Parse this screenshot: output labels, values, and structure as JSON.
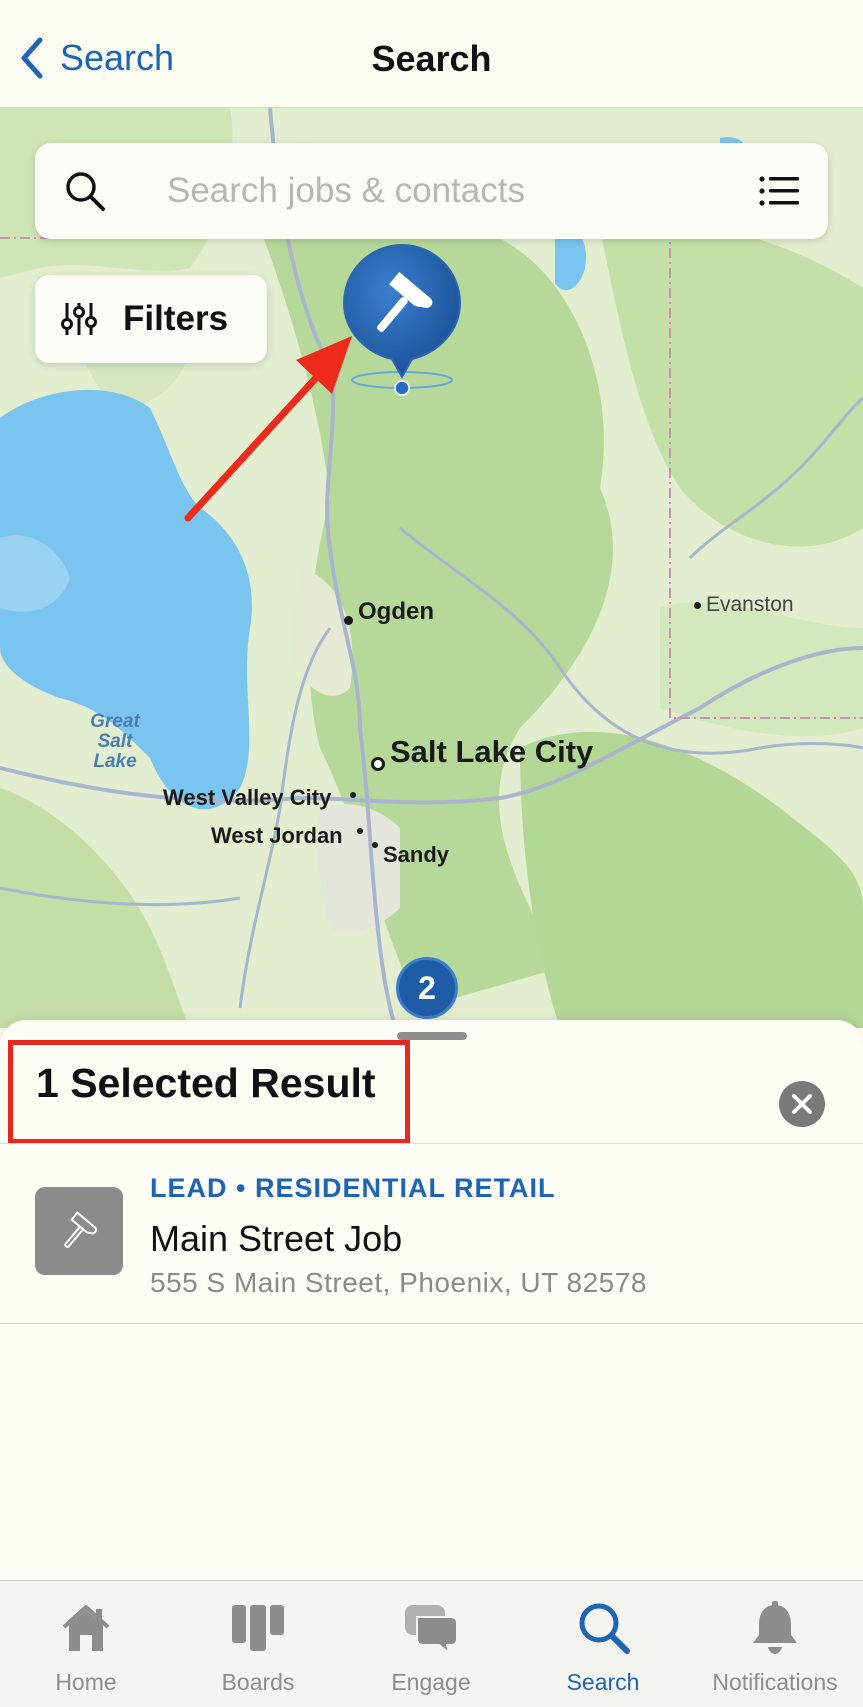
{
  "nav": {
    "back_label": "Search",
    "title": "Search"
  },
  "map": {
    "search_placeholder": "Search jobs & contacts",
    "filters_label": "Filters",
    "cluster_count": "2",
    "labels": {
      "ogden": "Ogden",
      "evanston": "Evanston",
      "salt_lake_city": "Salt Lake City",
      "west_valley_city": "West Valley City",
      "west_jordan": "West Jordan",
      "sandy": "Sandy",
      "lake_line1": "Great",
      "lake_line2": "Salt",
      "lake_line3": "Lake"
    }
  },
  "sheet": {
    "title": "1 Selected Result",
    "results": [
      {
        "type": "LEAD • RESIDENTIAL RETAIL",
        "title": "Main Street Job",
        "address": "555 S Main Street, Phoenix, UT 82578"
      }
    ]
  },
  "tabs": [
    {
      "label": "Home",
      "icon": "house-icon"
    },
    {
      "label": "Boards",
      "icon": "boards-icon"
    },
    {
      "label": "Engage",
      "icon": "chat-bubbles-icon"
    },
    {
      "label": "Search",
      "icon": "search-icon"
    },
    {
      "label": "Notifications",
      "icon": "bell-icon"
    }
  ],
  "colors": {
    "accent": "#1e64b4",
    "highlight": "#e8271e",
    "water": "#74c2ef",
    "forest": "#b9dc98"
  }
}
